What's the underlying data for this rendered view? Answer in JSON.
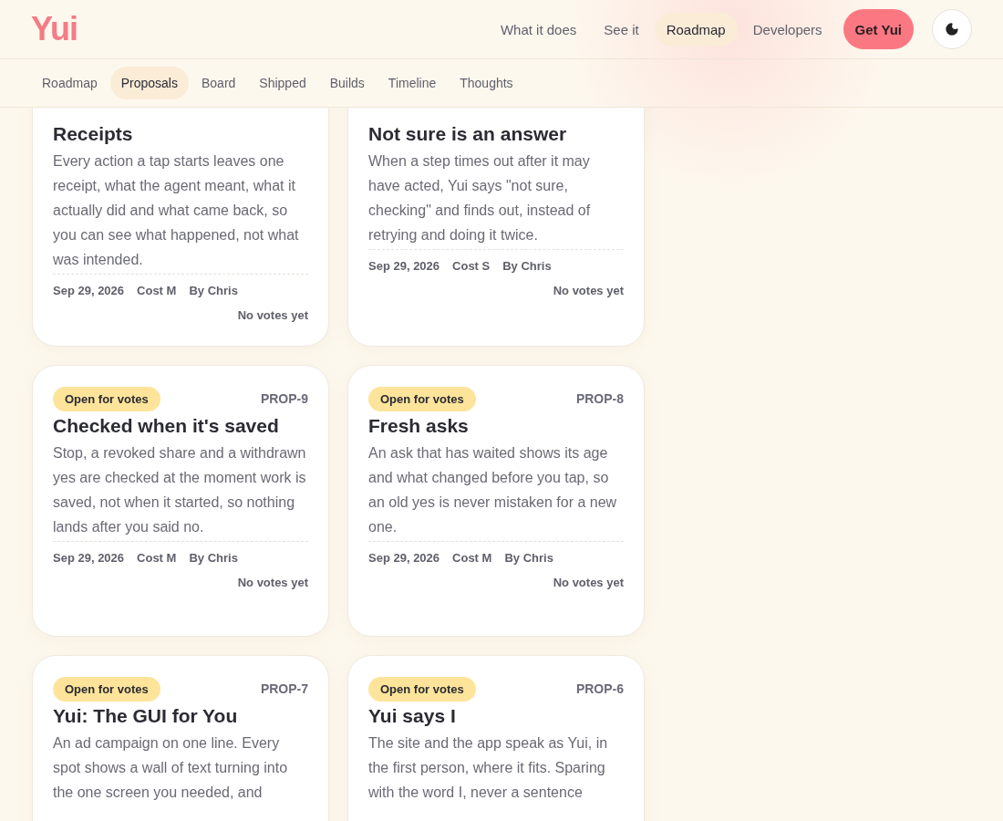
{
  "logo": "Yui",
  "nav": [
    {
      "label": "What it does",
      "selected": false
    },
    {
      "label": "See it",
      "selected": false
    },
    {
      "label": "Roadmap",
      "selected": true
    },
    {
      "label": "Developers",
      "selected": false
    }
  ],
  "cta": "Get Yui",
  "subnav": [
    {
      "label": "Roadmap",
      "selected": false
    },
    {
      "label": "Proposals",
      "selected": true
    },
    {
      "label": "Board",
      "selected": false
    },
    {
      "label": "Shipped",
      "selected": false
    },
    {
      "label": "Builds",
      "selected": false
    },
    {
      "label": "Timeline",
      "selected": false
    },
    {
      "label": "Thoughts",
      "selected": false
    }
  ],
  "cards": [
    {
      "title": "Receipts",
      "body": "Every action a tap starts leaves one receipt, what the agent meant, what it actually did and what came back, so you can see what happened, not what was intended.",
      "date": "Sep 29, 2026",
      "cost": "Cost M",
      "author": "By Chris",
      "votes": "No votes yet"
    },
    {
      "title": "Not sure is an answer",
      "body": "When a step times out after it may have acted, Yui says \"not sure, checking\" and finds out, instead of retrying and doing it twice.",
      "date": "Sep 29, 2026",
      "cost": "Cost S",
      "author": "By Chris",
      "votes": "No votes yet"
    },
    {
      "status": "Open for votes",
      "id": "PROP-9",
      "title": "Checked when it's saved",
      "body": "Stop, a revoked share and a withdrawn yes are checked at the moment work is saved, not when it started, so nothing lands after you said no.",
      "date": "Sep 29, 2026",
      "cost": "Cost M",
      "author": "By Chris",
      "votes": "No votes yet"
    },
    {
      "status": "Open for votes",
      "id": "PROP-8",
      "title": "Fresh asks",
      "body": "An ask that has waited shows its age and what changed before you tap, so an old yes is never mistaken for a new one.",
      "date": "Sep 29, 2026",
      "cost": "Cost M",
      "author": "By Chris",
      "votes": "No votes yet"
    },
    {
      "status": "Open for votes",
      "id": "PROP-7",
      "title": "Yui: The GUI for You",
      "body": "An ad campaign on one line. Every spot shows a wall of text turning into the one screen you needed, and"
    },
    {
      "status": "Open for votes",
      "id": "PROP-6",
      "title": "Yui says I",
      "body": "The site and the app speak as Yui, in the first person, where it fits. Sparing with the word I, never a sentence"
    }
  ]
}
